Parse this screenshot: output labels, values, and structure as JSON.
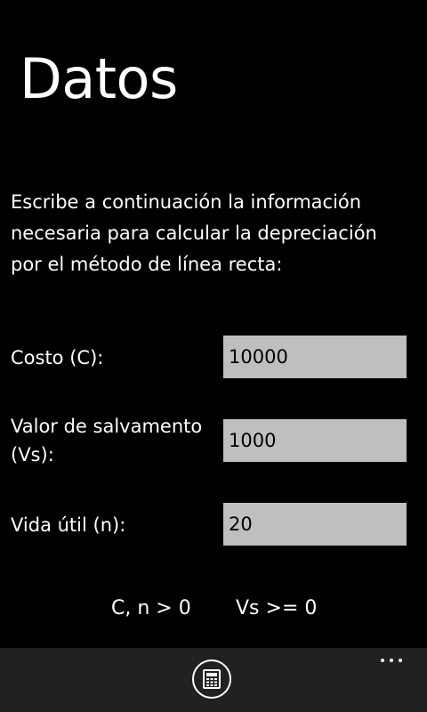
{
  "page": {
    "title": "Datos",
    "instructions": "Escribe a continuación la información necesaria para calcular la depreciación por el método de línea recta:"
  },
  "fields": {
    "cost": {
      "label": "Costo (C):",
      "value": "10000"
    },
    "salvage": {
      "label_line1": "Valor de salvamento",
      "label_line2": "(Vs):",
      "value": "1000"
    },
    "life": {
      "label": "Vida útil (n):",
      "value": "20"
    }
  },
  "constraints": {
    "first": "C, n > 0",
    "second": "Vs >= 0"
  },
  "app_bar": {
    "button_icon": "calculator-icon",
    "more_icon": "more-options-icon"
  }
}
